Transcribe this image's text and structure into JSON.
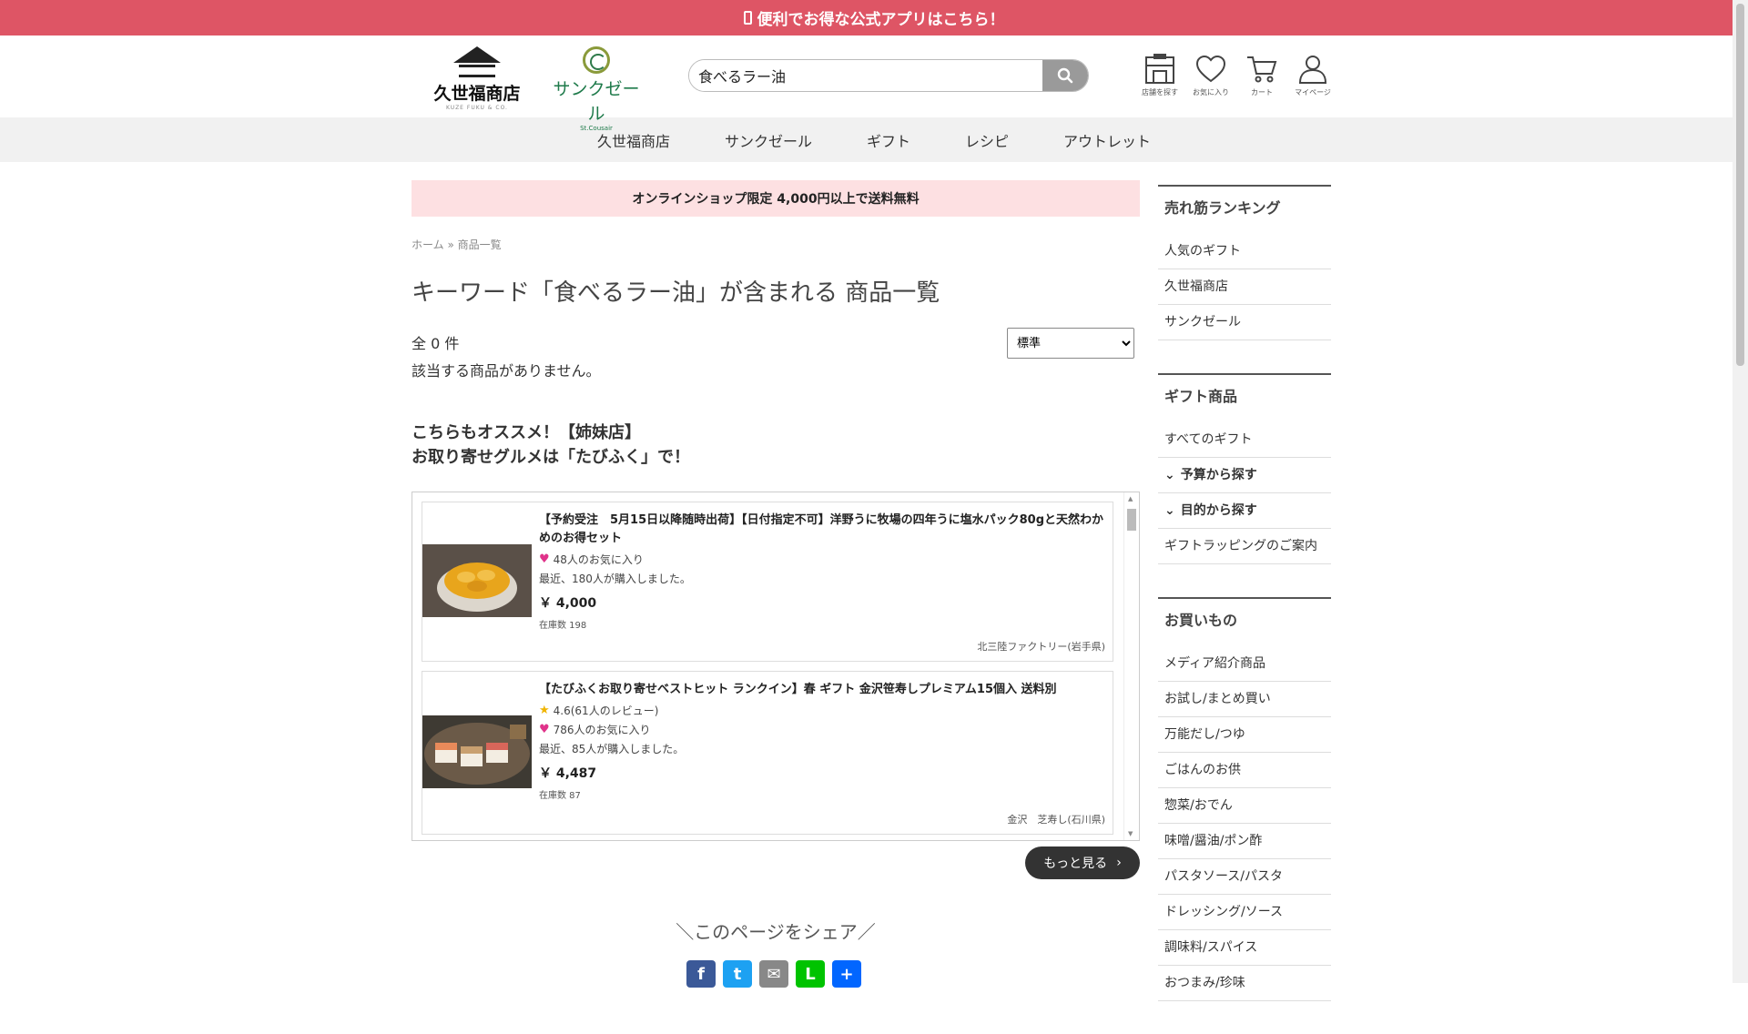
{
  "banner": {
    "text": "便利でお得な公式アプリはこちら！"
  },
  "logos": {
    "kuzefuku": {
      "name": "久世福商店",
      "sub": "KUZE FUKU & CO."
    },
    "stcousair": {
      "name": "サンクゼール",
      "sub": "St.Cousair"
    }
  },
  "search": {
    "value": "食べるラー油"
  },
  "header_icons": [
    {
      "label": "店舗を探す",
      "icon": "store-icon"
    },
    {
      "label": "お気に入り",
      "icon": "heart-icon"
    },
    {
      "label": "カート",
      "icon": "cart-icon"
    },
    {
      "label": "マイページ",
      "icon": "user-icon"
    }
  ],
  "nav": [
    "久世福商店",
    "サンクゼール",
    "ギフト",
    "レシピ",
    "アウトレット"
  ],
  "promo": "オンラインショップ限定 4,000円以上で送料無料",
  "breadcrumb": {
    "home": "ホーム",
    "sep": "»",
    "current": "商品一覧"
  },
  "page_title": "キーワード「食べるラー油」が含まれる 商品一覧",
  "count": "全 0 件",
  "sort": {
    "selected": "標準"
  },
  "empty_message": "該当する商品がありません。",
  "recommend": {
    "line1": "こちらもオススメ！【姉妹店】",
    "line2": "お取り寄せグルメは「たびふく」で！"
  },
  "products": [
    {
      "title": "【予約受注　5月15日以降随時出荷】【日付指定不可】洋野うに牧場の四年うに塩水パック80gと天然わかめのお得セット",
      "rating": "",
      "favorites": "48人のお気に入り",
      "purchased": "最近、180人が購入しました。",
      "price": "￥ 4,000",
      "stock": "在庫数 198",
      "shop": "北三陸ファクトリー(岩手県)"
    },
    {
      "title": "【たびふくお取り寄せベストヒット ランクイン】春 ギフト 金沢笹寿しプレミアム15個入 送料別",
      "rating": "4.6(61人のレビュー)",
      "favorites": "786人のお気に入り",
      "purchased": "最近、85人が購入しました。",
      "price": "￥ 4,487",
      "stock": "在庫数 87",
      "shop": "金沢　芝寿し(石川県)"
    }
  ],
  "more_button": "もっと見る",
  "share_title": "＼このページをシェア／",
  "share_icons": [
    "facebook-icon",
    "twitter-icon",
    "email-icon",
    "line-icon",
    "share-icon"
  ],
  "sidebar": {
    "ranking": {
      "title": "売れ筋ランキング",
      "items": [
        "人気のギフト",
        "久世福商店",
        "サンクゼール"
      ]
    },
    "gift": {
      "title": "ギフト商品",
      "items": [
        "すべてのギフト",
        "予算から探す",
        "目的から探す",
        "ギフトラッピングのご案内"
      ]
    },
    "shopping": {
      "title": "お買いもの",
      "items": [
        "メディア紹介商品",
        "お試し/まとめ買い",
        "万能だし/つゆ",
        "ごはんのお供",
        "惣菜/おでん",
        "味噌/醤油/ポン酢",
        "パスタソース/パスタ",
        "ドレッシング/ソース",
        "調味料/スパイス",
        "おつまみ/珍味"
      ]
    }
  },
  "colors": {
    "banner": "#de5565",
    "promo_bg": "#fde0e2",
    "heart": "#e0338a",
    "star": "#f0b400"
  }
}
